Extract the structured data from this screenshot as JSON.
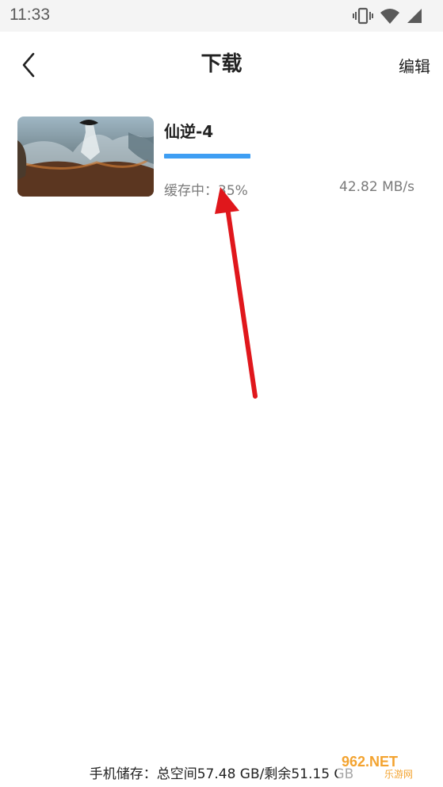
{
  "status_bar": {
    "time": "11:33",
    "icons": [
      "vibrate-icon",
      "wifi-icon",
      "cellular-icon"
    ]
  },
  "header": {
    "title": "下载",
    "edit_label": "编辑",
    "back_icon": "chevron-left-icon"
  },
  "downloads": [
    {
      "title": "仙逆-4",
      "status_label": "缓存中：35%",
      "speed": "42.82 MB/s",
      "progress": 0.35
    }
  ],
  "footer": {
    "storage_text": "手机储存：总空间57.48 GB/剩余51.15 GB"
  },
  "watermark": {
    "text": "962.NET",
    "sub": "乐游网"
  },
  "colors": {
    "accent": "#3e9ef3",
    "annotation_arrow": "#e0171c"
  }
}
